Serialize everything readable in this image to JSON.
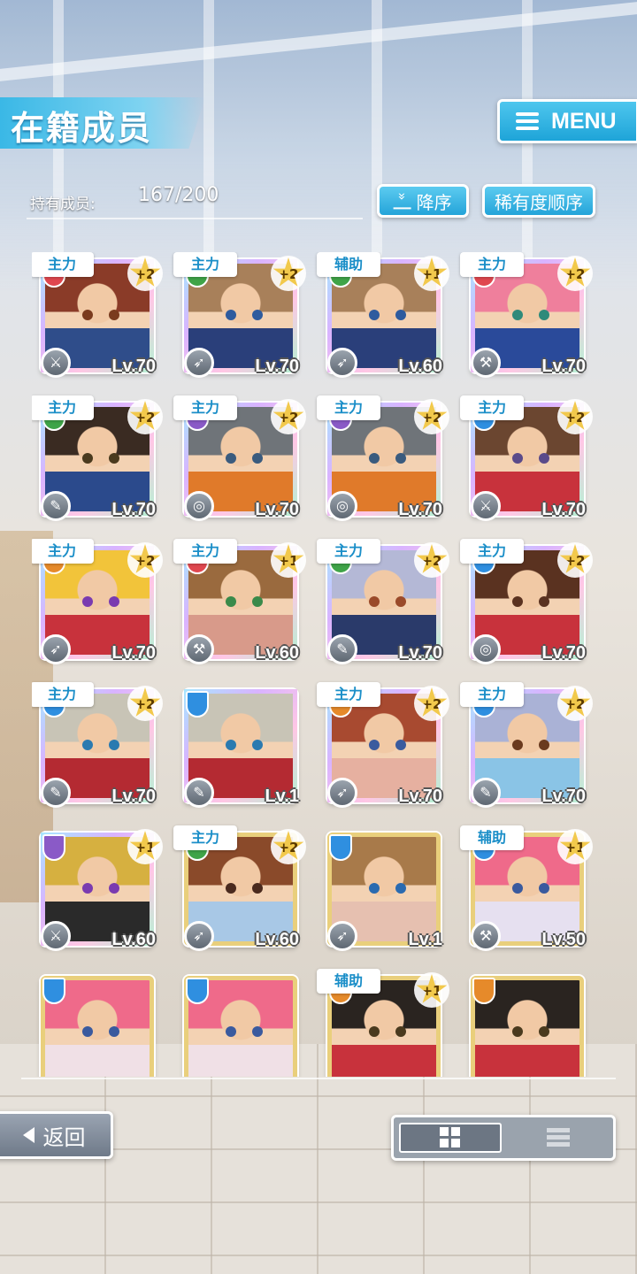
{
  "header": {
    "title": "在籍成员",
    "menu_label": "MENU"
  },
  "owned": {
    "label": "持有成员:",
    "value": "167/200"
  },
  "sort": {
    "order_label": "降序",
    "order_icon": "double-chevron-down-icon",
    "key_label": "稀有度顺序"
  },
  "cards": [
    {
      "role": "主力",
      "plus": "+2",
      "level": "Lv.70",
      "shield": "#e0474f",
      "hair": "#8a3b28",
      "cloth": "#2f4d8a",
      "eye": "#7a3b1e",
      "weapon": "⚔",
      "frame": "rainbow"
    },
    {
      "role": "主力",
      "plus": "+2",
      "level": "Lv.70",
      "shield": "#3fa448",
      "hair": "#a8805a",
      "cloth": "#2a3f7a",
      "eye": "#2e5b9e",
      "weapon": "➶",
      "frame": "rainbow"
    },
    {
      "role": "辅助",
      "plus": "+1",
      "level": "Lv.60",
      "shield": "#3fa448",
      "hair": "#a8805a",
      "cloth": "#2a3f7a",
      "eye": "#2e5b9e",
      "weapon": "➶",
      "frame": "rainbow"
    },
    {
      "role": "主力",
      "plus": "+2",
      "level": "Lv.70",
      "shield": "#e0474f",
      "hair": "#ef7f9c",
      "cloth": "#2a4a9a",
      "eye": "#2e8a7a",
      "weapon": "⚒",
      "frame": "rainbow"
    },
    {
      "role": "主力",
      "plus": "+2",
      "level": "Lv.70",
      "shield": "#3fa448",
      "hair": "#3a2b22",
      "cloth": "#2b4a8c",
      "eye": "#4a3a1e",
      "weapon": "✎",
      "frame": "rainbow"
    },
    {
      "role": "主力",
      "plus": "+2",
      "level": "Lv.70",
      "shield": "#8a5ac7",
      "hair": "#6f7479",
      "cloth": "#e07a2a",
      "eye": "#3a5b7e",
      "weapon": "◎",
      "frame": "rainbow"
    },
    {
      "role": "主力",
      "plus": "+2",
      "level": "Lv.70",
      "shield": "#8a5ac7",
      "hair": "#6f7479",
      "cloth": "#e07a2a",
      "eye": "#3a5b7e",
      "weapon": "◎",
      "frame": "rainbow"
    },
    {
      "role": "主力",
      "plus": "+2",
      "level": "Lv.70",
      "shield": "#2f8fe0",
      "hair": "#6b4630",
      "cloth": "#c8323c",
      "eye": "#5a4a8a",
      "weapon": "⚔",
      "frame": "rainbow"
    },
    {
      "role": "主力",
      "plus": "+2",
      "level": "Lv.70",
      "shield": "#e68a2a",
      "hair": "#f2c43a",
      "cloth": "#c8323c",
      "eye": "#7a3bb0",
      "weapon": "➶",
      "frame": "rainbow"
    },
    {
      "role": "主力",
      "plus": "+1",
      "level": "Lv.60",
      "shield": "#e0474f",
      "hair": "#9a6a3e",
      "cloth": "#d89a8a",
      "eye": "#3a8a4a",
      "weapon": "⚒",
      "frame": "rainbow"
    },
    {
      "role": "主力",
      "plus": "+2",
      "level": "Lv.70",
      "shield": "#3fa448",
      "hair": "#b4b8d6",
      "cloth": "#2a3a6a",
      "eye": "#9a4a2a",
      "weapon": "✎",
      "frame": "rainbow"
    },
    {
      "role": "主力",
      "plus": "+2",
      "level": "Lv.70",
      "shield": "#2f8fe0",
      "hair": "#5a3220",
      "cloth": "#c8323c",
      "eye": "#5a3220",
      "weapon": "◎",
      "frame": "rainbow"
    },
    {
      "role": "主力",
      "plus": "+2",
      "level": "Lv.70",
      "shield": "#2f8fe0",
      "hair": "#c8c4b6",
      "cloth": "#b42a32",
      "eye": "#2a7ab0",
      "weapon": "✎",
      "frame": "rainbow"
    },
    {
      "role": "",
      "plus": "",
      "level": "Lv.1",
      "shield": "#2f8fe0",
      "hair": "#c8c4b6",
      "cloth": "#b42a32",
      "eye": "#2a7ab0",
      "weapon": "✎",
      "frame": "rainbow"
    },
    {
      "role": "主力",
      "plus": "+2",
      "level": "Lv.70",
      "shield": "#e68a2a",
      "hair": "#a84a30",
      "cloth": "#e6b0a0",
      "eye": "#3a5b9e",
      "weapon": "➶",
      "frame": "rainbow"
    },
    {
      "role": "主力",
      "plus": "+2",
      "level": "Lv.70",
      "shield": "#2f8fe0",
      "hair": "#aab2d6",
      "cloth": "#8ac4e6",
      "eye": "#6a3a1e",
      "weapon": "✎",
      "frame": "rainbow"
    },
    {
      "role": "",
      "plus": "+1",
      "level": "Lv.60",
      "shield": "#8a5ac7",
      "hair": "#d6b040",
      "cloth": "#2a2a2a",
      "eye": "#7a3bb0",
      "weapon": "⚔",
      "frame": "rainbow"
    },
    {
      "role": "主力",
      "plus": "+2",
      "level": "Lv.60",
      "shield": "#3fa448",
      "hair": "#8a4a2a",
      "cloth": "#a8c8e6",
      "eye": "#4a2a1e",
      "weapon": "➶",
      "frame": "gold"
    },
    {
      "role": "",
      "plus": "",
      "level": "Lv.1",
      "shield": "#2f8fe0",
      "hair": "#a87a4a",
      "cloth": "#e6c0b0",
      "eye": "#2a6ab0",
      "weapon": "➶",
      "frame": "gold"
    },
    {
      "role": "辅助",
      "plus": "+1",
      "level": "Lv.50",
      "shield": "#2f8fe0",
      "hair": "#ef6a8a",
      "cloth": "#e6e0f0",
      "eye": "#3a5a9e",
      "weapon": "⚒",
      "frame": "gold"
    },
    {
      "role": "",
      "plus": "",
      "level": "",
      "shield": "#2f8fe0",
      "hair": "#ef6a8a",
      "cloth": "#f0e0e6",
      "eye": "#3a5a9e",
      "weapon": "",
      "frame": "gold"
    },
    {
      "role": "",
      "plus": "",
      "level": "",
      "shield": "#2f8fe0",
      "hair": "#ef6a8a",
      "cloth": "#f0e0e6",
      "eye": "#3a5a9e",
      "weapon": "",
      "frame": "gold"
    },
    {
      "role": "辅助",
      "plus": "+1",
      "level": "",
      "shield": "#e68a2a",
      "hair": "#2a2420",
      "cloth": "#c8323c",
      "eye": "#4a3a1e",
      "weapon": "",
      "frame": "gold"
    },
    {
      "role": "",
      "plus": "",
      "level": "",
      "shield": "#e68a2a",
      "hair": "#2a2420",
      "cloth": "#c8323c",
      "eye": "#4a3a1e",
      "weapon": "",
      "frame": "gold"
    }
  ],
  "footer": {
    "back_label": "返回",
    "back_icon": "triangle-left-icon",
    "view_grid_icon": "grid-view-icon",
    "view_list_icon": "list-view-icon"
  }
}
